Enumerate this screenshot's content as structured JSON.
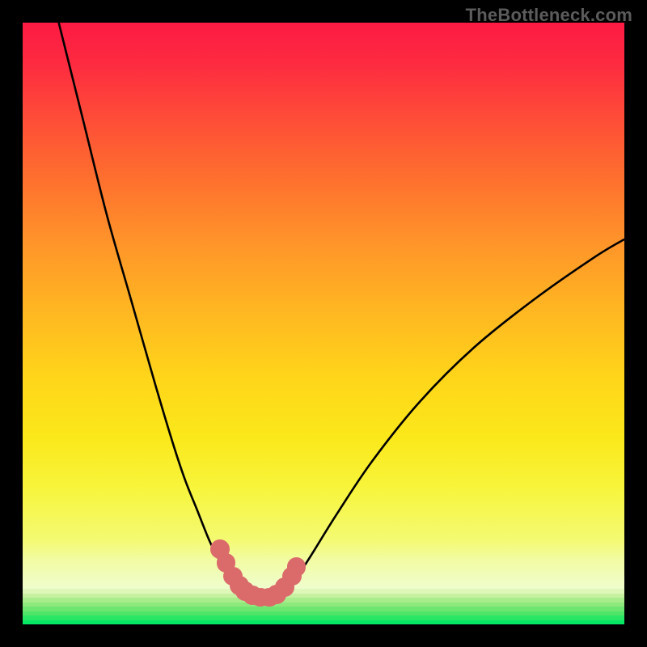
{
  "watermark": "TheBottleneck.com",
  "colors": {
    "black": "#000000",
    "curve": "#000000",
    "marker": "#db6b6b",
    "gradient_top": "#fd1a43",
    "gradient_mid": "#ffc31d",
    "gradient_yellow": "#f7f53c",
    "green_final": "#06e763"
  },
  "chart_data": {
    "type": "line",
    "title": "",
    "xlabel": "",
    "ylabel": "",
    "xlim": [
      0,
      100
    ],
    "ylim": [
      0,
      100
    ],
    "series": [
      {
        "name": "left-branch",
        "x": [
          6,
          10,
          14,
          18,
          22,
          25,
          27,
          29,
          31,
          32.5,
          34,
          35,
          36,
          37,
          38
        ],
        "y": [
          100,
          84,
          68,
          54,
          40,
          30,
          24,
          19,
          14,
          11,
          8.5,
          7,
          5.8,
          5,
          4.5
        ]
      },
      {
        "name": "right-branch",
        "x": [
          42,
          44,
          47,
          52,
          58,
          66,
          75,
          85,
          95,
          100
        ],
        "y": [
          4.5,
          6,
          10,
          18,
          27,
          37,
          46,
          54,
          61,
          64
        ]
      }
    ],
    "valley_floor": {
      "x_range": [
        38,
        42
      ],
      "y": 4.5
    },
    "markers": [
      {
        "x": 32.8,
        "y": 12.5,
        "r": 1.6
      },
      {
        "x": 33.8,
        "y": 10.2,
        "r": 1.6
      },
      {
        "x": 35.0,
        "y": 8.0,
        "r": 1.6
      },
      {
        "x": 36.0,
        "y": 6.5,
        "r": 1.6
      },
      {
        "x": 37.0,
        "y": 5.5,
        "r": 1.6
      },
      {
        "x": 38.2,
        "y": 4.8,
        "r": 1.6
      },
      {
        "x": 39.5,
        "y": 4.5,
        "r": 1.6
      },
      {
        "x": 41.0,
        "y": 4.5,
        "r": 1.6
      },
      {
        "x": 42.2,
        "y": 5.0,
        "r": 1.6
      },
      {
        "x": 43.5,
        "y": 6.2,
        "r": 1.6
      },
      {
        "x": 44.8,
        "y": 8.0,
        "r": 1.6
      },
      {
        "x": 45.5,
        "y": 9.5,
        "r": 1.6
      }
    ],
    "green_bands": [
      "#dff7b8",
      "#c5f1a0",
      "#a8ec8b",
      "#8de97c",
      "#6fe670",
      "#4fe568",
      "#2ae665",
      "#06e763"
    ]
  }
}
